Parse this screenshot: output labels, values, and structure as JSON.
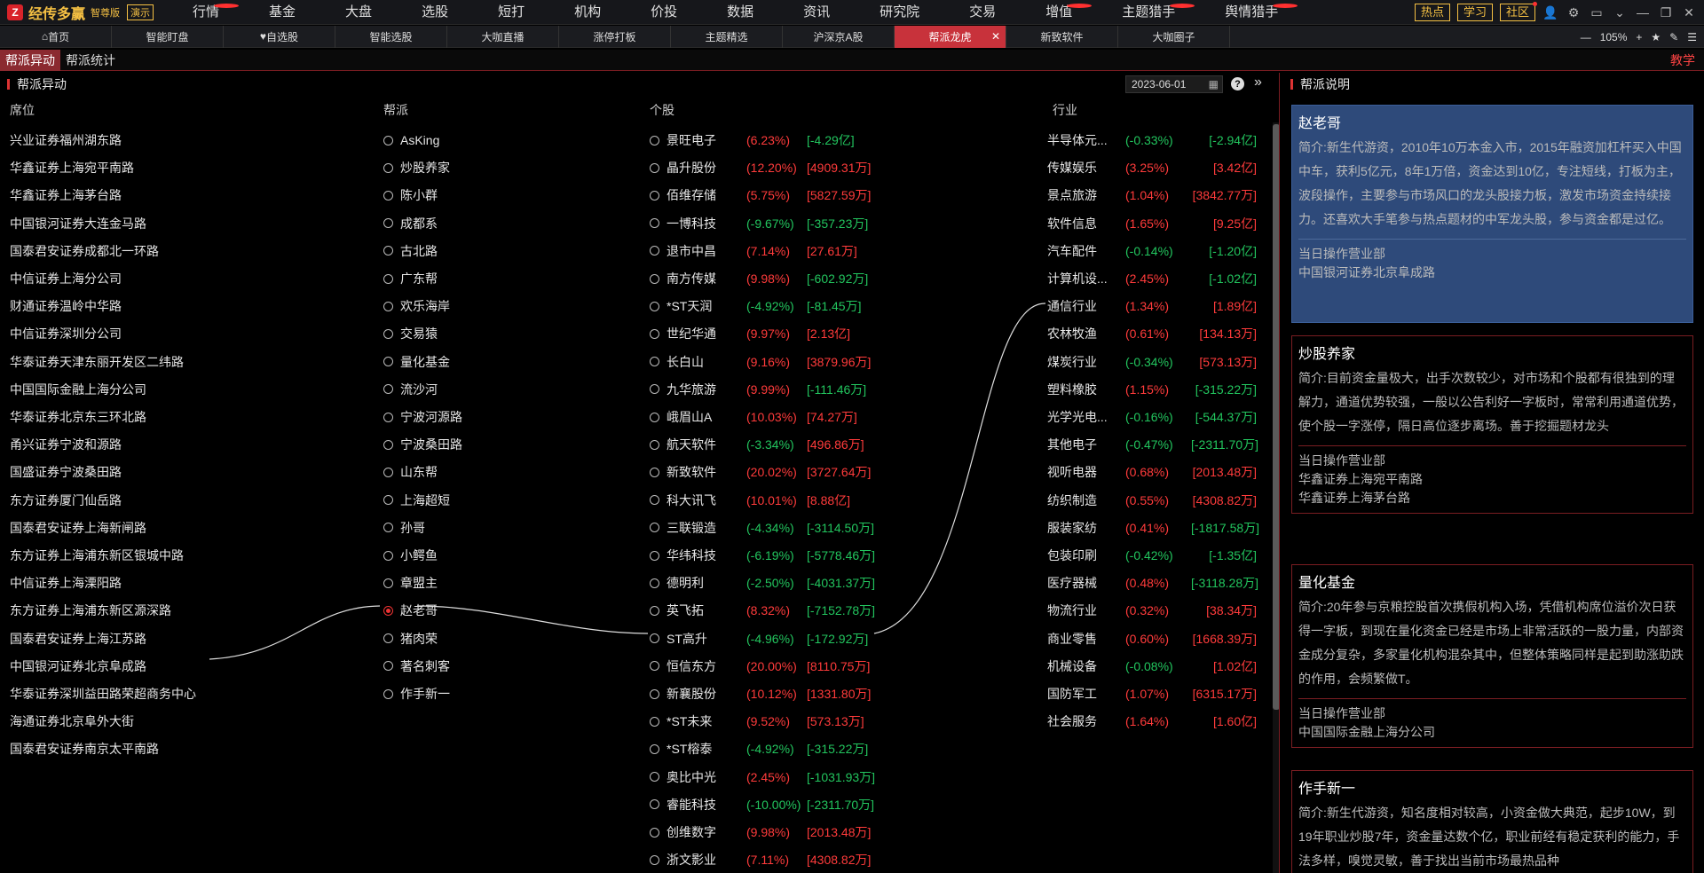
{
  "topbar": {
    "logo": "经传多赢",
    "edition": "智尊版",
    "demo": "演示",
    "menu": [
      {
        "label": "行情",
        "dot": true
      },
      {
        "label": "基金"
      },
      {
        "label": "大盘"
      },
      {
        "label": "选股"
      },
      {
        "label": "短打"
      },
      {
        "label": "机构"
      },
      {
        "label": "价投"
      },
      {
        "label": "数据"
      },
      {
        "label": "资讯"
      },
      {
        "label": "研究院"
      },
      {
        "label": "交易"
      },
      {
        "label": "增值",
        "dot": true
      },
      {
        "label": "主题猎手",
        "dot": true,
        "hl": true
      },
      {
        "label": "舆情猎手",
        "dot": true,
        "hl": true
      }
    ],
    "right": [
      "热点",
      "学习",
      "社区"
    ]
  },
  "tabs": [
    "首页",
    "智能盯盘",
    "自选股",
    "智能选股",
    "大咖直播",
    "涨停打板",
    "主题精选",
    "沪深京A股",
    "帮派龙虎",
    "新致软件",
    "大咖圈子"
  ],
  "active_tab": "帮派龙虎",
  "zoom": "105%",
  "subtabs": [
    "帮派异动",
    "帮派统计"
  ],
  "teach": "教学",
  "panel_title": "帮派异动",
  "date": "2023-06-01",
  "right_title": "帮派说明",
  "columns": {
    "seat": "席位",
    "gang": "帮派",
    "stock": "个股",
    "industry": "行业"
  },
  "seats": [
    "兴业证券福州湖东路",
    "华鑫证券上海宛平南路",
    "华鑫证券上海茅台路",
    "中国银河证券大连金马路",
    "国泰君安证券成都北一环路",
    "中信证券上海分公司",
    "财通证券温岭中华路",
    "中信证券深圳分公司",
    "华泰证券天津东丽开发区二纬路",
    "中国国际金融上海分公司",
    "华泰证券北京东三环北路",
    "甬兴证券宁波和源路",
    "国盛证券宁波桑田路",
    "东方证券厦门仙岳路",
    "国泰君安证券上海新闸路",
    "东方证券上海浦东新区银城中路",
    "中信证券上海溧阳路",
    "东方证券上海浦东新区源深路",
    "国泰君安证券上海江苏路",
    "中国银河证券北京阜成路",
    "华泰证券深圳益田路荣超商务中心",
    "海通证券北京阜外大街",
    "国泰君安证券南京太平南路"
  ],
  "gangs": [
    "AsKing",
    "炒股养家",
    "陈小群",
    "成都系",
    "古北路",
    "广东帮",
    "欢乐海岸",
    "交易猿",
    "量化基金",
    "流沙河",
    "宁波河源路",
    "宁波桑田路",
    "山东帮",
    "上海超短",
    "孙哥",
    "小鳄鱼",
    "章盟主",
    "赵老哥",
    "猪肉荣",
    "著名刺客",
    "作手新一"
  ],
  "selected_gang": "赵老哥",
  "stocks": [
    {
      "name": "景旺电子",
      "pct": "(6.23%)",
      "amt": "[-4.29亿]",
      "pu": true,
      "au": false
    },
    {
      "name": "晶升股份",
      "pct": "(12.20%)",
      "amt": "[4909.31万]",
      "pu": true,
      "au": true
    },
    {
      "name": "佰维存储",
      "pct": "(5.75%)",
      "amt": "[5827.59万]",
      "pu": true,
      "au": true
    },
    {
      "name": "一博科技",
      "pct": "(-9.67%)",
      "amt": "[-357.23万]",
      "pu": false,
      "au": false
    },
    {
      "name": "退市中昌",
      "pct": "(7.14%)",
      "amt": "[27.61万]",
      "pu": true,
      "au": true
    },
    {
      "name": "南方传媒",
      "pct": "(9.98%)",
      "amt": "[-602.92万]",
      "pu": true,
      "au": false
    },
    {
      "name": "*ST天润",
      "pct": "(-4.92%)",
      "amt": "[-81.45万]",
      "pu": false,
      "au": false
    },
    {
      "name": "世纪华通",
      "pct": "(9.97%)",
      "amt": "[2.13亿]",
      "pu": true,
      "au": true
    },
    {
      "name": "长白山",
      "pct": "(9.16%)",
      "amt": "[3879.96万]",
      "pu": true,
      "au": true
    },
    {
      "name": "九华旅游",
      "pct": "(9.99%)",
      "amt": "[-111.46万]",
      "pu": true,
      "au": false
    },
    {
      "name": "峨眉山A",
      "pct": "(10.03%)",
      "amt": "[74.27万]",
      "pu": true,
      "au": true
    },
    {
      "name": "航天软件",
      "pct": "(-3.34%)",
      "amt": "[496.86万]",
      "pu": false,
      "au": true
    },
    {
      "name": "新致软件",
      "pct": "(20.02%)",
      "amt": "[3727.64万]",
      "pu": true,
      "au": true
    },
    {
      "name": "科大讯飞",
      "pct": "(10.01%)",
      "amt": "[8.88亿]",
      "pu": true,
      "au": true
    },
    {
      "name": "三联锻造",
      "pct": "(-4.34%)",
      "amt": "[-3114.50万]",
      "pu": false,
      "au": false
    },
    {
      "name": "华纬科技",
      "pct": "(-6.19%)",
      "amt": "[-5778.46万]",
      "pu": false,
      "au": false
    },
    {
      "name": "德明利",
      "pct": "(-2.50%)",
      "amt": "[-4031.37万]",
      "pu": false,
      "au": false
    },
    {
      "name": "英飞拓",
      "pct": "(8.32%)",
      "amt": "[-7152.78万]",
      "pu": true,
      "au": false
    },
    {
      "name": "ST高升",
      "pct": "(-4.96%)",
      "amt": "[-172.92万]",
      "pu": false,
      "au": false
    },
    {
      "name": "恒信东方",
      "pct": "(20.00%)",
      "amt": "[8110.75万]",
      "pu": true,
      "au": true
    },
    {
      "name": "新襄股份",
      "pct": "(10.12%)",
      "amt": "[1331.80万]",
      "pu": true,
      "au": true
    },
    {
      "name": "*ST未来",
      "pct": "(9.52%)",
      "amt": "[573.13万]",
      "pu": true,
      "au": true
    },
    {
      "name": "*ST榕泰",
      "pct": "(-4.92%)",
      "amt": "[-315.22万]",
      "pu": false,
      "au": false
    },
    {
      "name": "奥比中光",
      "pct": "(2.45%)",
      "amt": "[-1031.93万]",
      "pu": true,
      "au": false
    },
    {
      "name": "睿能科技",
      "pct": "(-10.00%)",
      "amt": "[-2311.70万]",
      "pu": false,
      "au": false
    },
    {
      "name": "创维数字",
      "pct": "(9.98%)",
      "amt": "[2013.48万]",
      "pu": true,
      "au": true
    },
    {
      "name": "浙文影业",
      "pct": "(7.11%)",
      "amt": "[4308.82万]",
      "pu": true,
      "au": true
    }
  ],
  "industries": [
    {
      "name": "半导体元...",
      "pct": "(-0.33%)",
      "amt": "[-2.94亿]",
      "pu": false,
      "au": false
    },
    {
      "name": "传媒娱乐",
      "pct": "(3.25%)",
      "amt": "[3.42亿]",
      "pu": true,
      "au": true
    },
    {
      "name": "景点旅游",
      "pct": "(1.04%)",
      "amt": "[3842.77万]",
      "pu": true,
      "au": true
    },
    {
      "name": "软件信息",
      "pct": "(1.65%)",
      "amt": "[9.25亿]",
      "pu": true,
      "au": true
    },
    {
      "name": "汽车配件",
      "pct": "(-0.14%)",
      "amt": "[-1.20亿]",
      "pu": false,
      "au": false
    },
    {
      "name": "计算机设...",
      "pct": "(2.45%)",
      "amt": "[-1.02亿]",
      "pu": true,
      "au": false
    },
    {
      "name": "通信行业",
      "pct": "(1.34%)",
      "amt": "[1.89亿]",
      "pu": true,
      "au": true
    },
    {
      "name": "农林牧渔",
      "pct": "(0.61%)",
      "amt": "[134.13万]",
      "pu": true,
      "au": true
    },
    {
      "name": "煤炭行业",
      "pct": "(-0.34%)",
      "amt": "[573.13万]",
      "pu": false,
      "au": true
    },
    {
      "name": "塑料橡胶",
      "pct": "(1.15%)",
      "amt": "[-315.22万]",
      "pu": true,
      "au": false
    },
    {
      "name": "光学光电...",
      "pct": "(-0.16%)",
      "amt": "[-544.37万]",
      "pu": false,
      "au": false
    },
    {
      "name": "其他电子",
      "pct": "(-0.47%)",
      "amt": "[-2311.70万]",
      "pu": false,
      "au": false
    },
    {
      "name": "视听电器",
      "pct": "(0.68%)",
      "amt": "[2013.48万]",
      "pu": true,
      "au": true
    },
    {
      "name": "纺织制造",
      "pct": "(0.55%)",
      "amt": "[4308.82万]",
      "pu": true,
      "au": true
    },
    {
      "name": "服装家纺",
      "pct": "(0.41%)",
      "amt": "[-1817.58万]",
      "pu": true,
      "au": false
    },
    {
      "name": "包装印刷",
      "pct": "(-0.42%)",
      "amt": "[-1.35亿]",
      "pu": false,
      "au": false
    },
    {
      "name": "医疗器械",
      "pct": "(0.48%)",
      "amt": "[-3118.28万]",
      "pu": true,
      "au": false
    },
    {
      "name": "物流行业",
      "pct": "(0.32%)",
      "amt": "[38.34万]",
      "pu": true,
      "au": true
    },
    {
      "name": "商业零售",
      "pct": "(0.60%)",
      "amt": "[1668.39万]",
      "pu": true,
      "au": true
    },
    {
      "name": "机械设备",
      "pct": "(-0.08%)",
      "amt": "[1.02亿]",
      "pu": false,
      "au": true
    },
    {
      "name": "国防军工",
      "pct": "(1.07%)",
      "amt": "[6315.17万]",
      "pu": true,
      "au": true
    },
    {
      "name": "社会服务",
      "pct": "(1.64%)",
      "amt": "[1.60亿]",
      "pu": true,
      "au": true
    }
  ],
  "cards": [
    {
      "title": "赵老哥",
      "desc": "简介:新生代游资，2010年10万本金入市，2015年融资加杠杆买入中国中车，获利5亿元，8年1万倍，资金达到10亿，专注短线，打板为主，波段操作，主要参与市场风口的龙头股接力板，激发市场资金持续接力。还喜欢大手笔参与热点题材的中军龙头股，参与资金都是过亿。",
      "label": "当日操作营业部",
      "value": "中国银河证券北京阜成路"
    },
    {
      "title": "炒股养家",
      "desc": "简介:目前资金量极大，出手次数较少，对市场和个股都有很独到的理解力，通道优势较强，一般以公告利好一字板时，常常利用通道优势，使个股一字涨停，隔日高位逐步离场。善于挖掘题材龙头",
      "label": "当日操作营业部",
      "value": "华鑫证券上海宛平南路\n华鑫证券上海茅台路"
    },
    {
      "title": "量化基金",
      "desc": "简介:20年参与京粮控股首次携假机构入场，凭借机构席位溢价次日获得一字板，到现在量化资金已经是市场上非常活跃的一股力量，内部资金成分复杂，多家量化机构混杂其中，但整体策略同样是起到助涨助跌的作用，会频繁做T。",
      "label": "当日操作营业部",
      "value": "中国国际金融上海分公司"
    },
    {
      "title": "作手新一",
      "desc": "简介:新生代游资，知名度相对较高，小资金做大典范，起步10W，到19年职业炒股7年，资金量达数个亿，职业前经有稳定获利的能力，手法多样，嗅觉灵敏，善于找出当前市场最热品种",
      "label": "",
      "value": ""
    }
  ]
}
